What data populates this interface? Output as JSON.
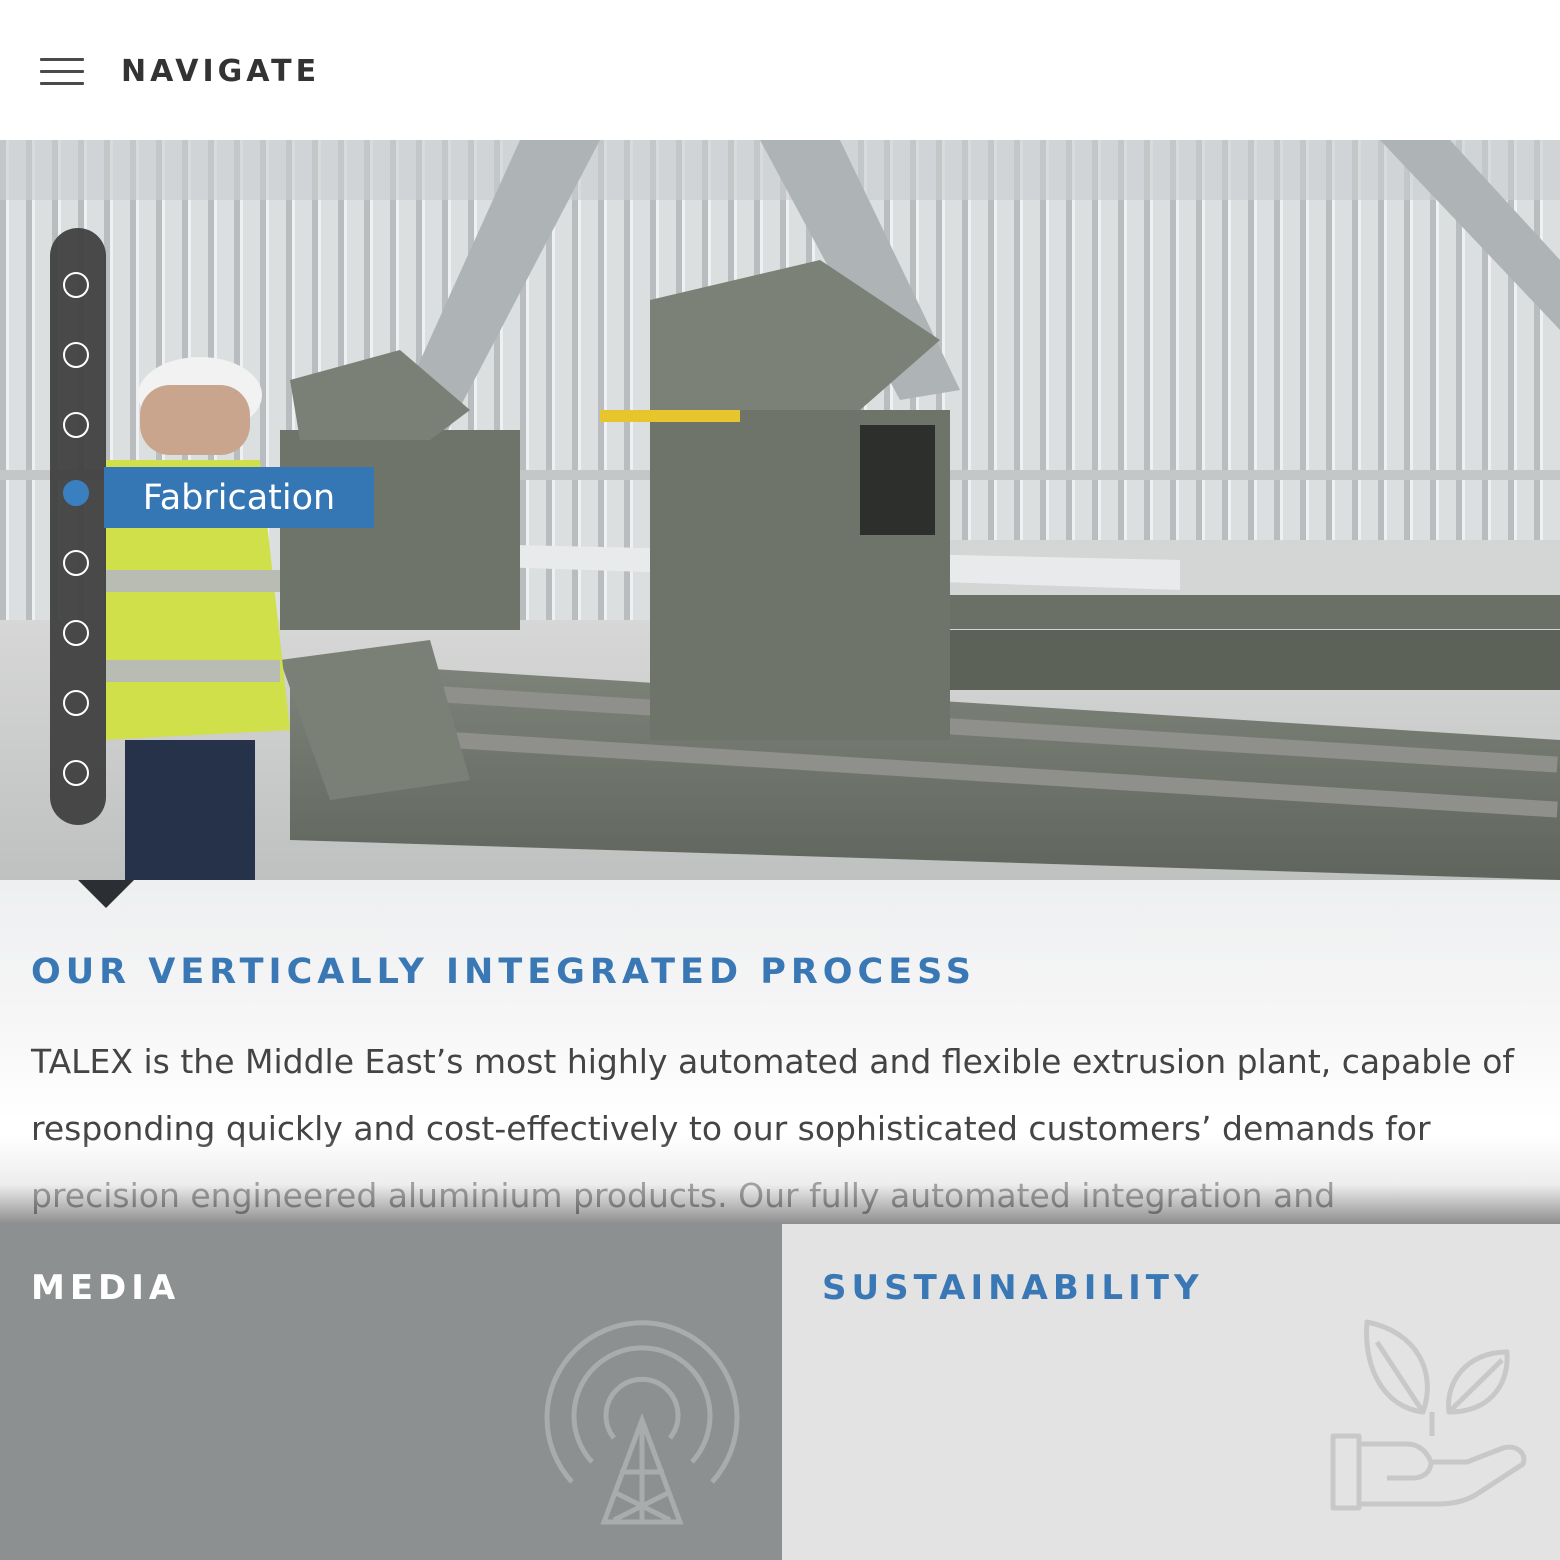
{
  "header": {
    "menu_icon": "hamburger-menu-icon",
    "nav_label": "NAVIGATE"
  },
  "hero": {
    "image_subject": "worker operating aluminium cutting machine in factory",
    "dot_nav": {
      "total": 8,
      "active_index": 3,
      "active_label": "Fabrication"
    }
  },
  "section": {
    "title": "OUR VERTICALLY INTEGRATED PROCESS",
    "body": "TALEX is the Middle East’s most highly automated and flexible extrusion plant, capable of responding quickly and cost-effectively to our sophisticated customers’ demands for precision engineered aluminium products. Our fully automated integration and"
  },
  "tiles": [
    {
      "title": "MEDIA",
      "icon": "broadcast-tower-icon"
    },
    {
      "title": "SUSTAINABILITY",
      "icon": "hand-with-leaves-icon"
    }
  ],
  "colors": {
    "accent_blue": "#3577b4",
    "media_tile": "#8c9090",
    "sustainability_tile": "#e3e3e4"
  }
}
